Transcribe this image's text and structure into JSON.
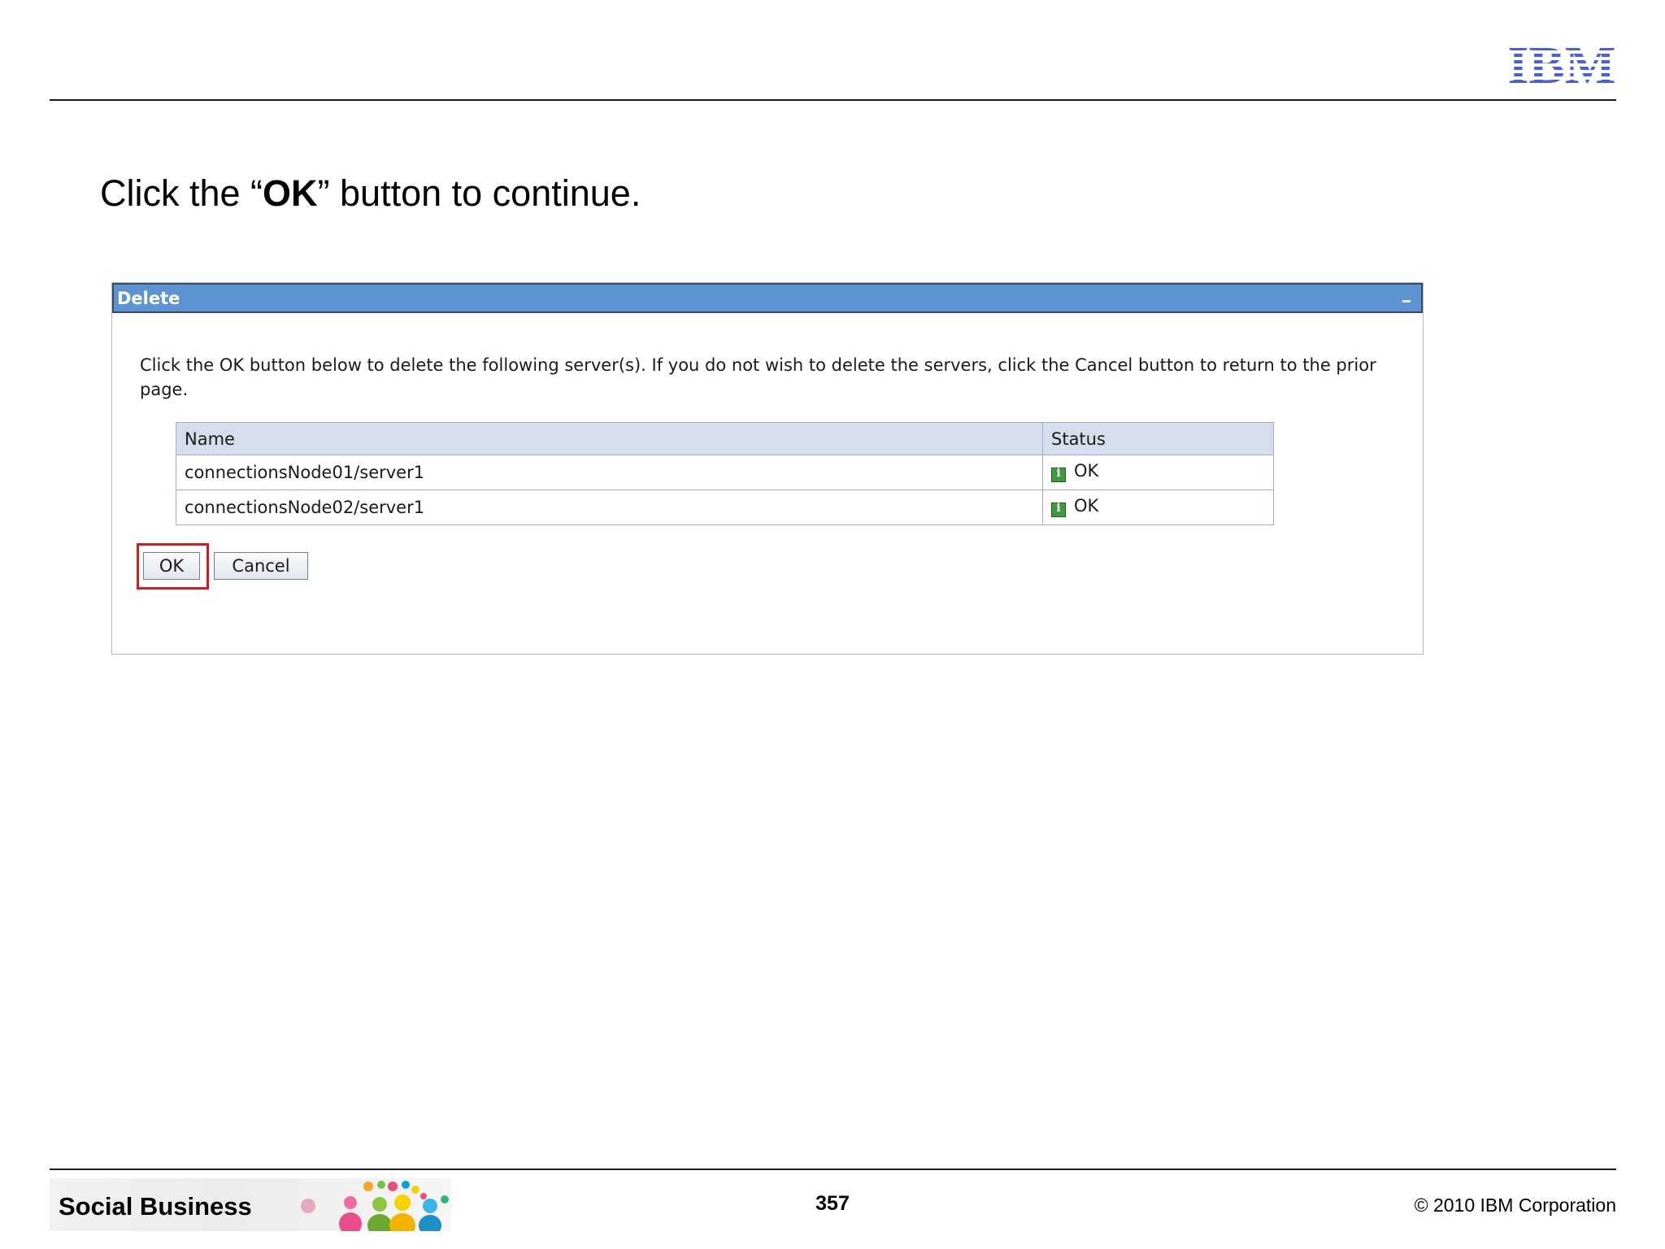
{
  "header": {
    "logo_text": "IBM"
  },
  "instruction": {
    "prefix": "Click the “",
    "emphasis": "OK",
    "suffix": "” button to continue."
  },
  "dialog": {
    "title": "Delete",
    "message": "Click the OK button below to delete the following server(s). If you do not wish to delete the servers, click the Cancel button to return to the prior page.",
    "table": {
      "columns": [
        "Name",
        "Status"
      ],
      "rows": [
        {
          "name": "connectionsNode01/server1",
          "status": "OK",
          "status_icon": "info-icon"
        },
        {
          "name": "connectionsNode02/server1",
          "status": "OK",
          "status_icon": "info-icon"
        }
      ]
    },
    "buttons": {
      "ok": "OK",
      "cancel": "Cancel"
    }
  },
  "footer": {
    "banner_title": "Social Business",
    "page_number": "357",
    "copyright": "© 2010 IBM Corporation"
  },
  "colors": {
    "title_bar": "#5b93d3",
    "table_header": "#d6deeb",
    "highlight": "#cc1f1f",
    "ibm_blue": "#4b5fd6"
  }
}
